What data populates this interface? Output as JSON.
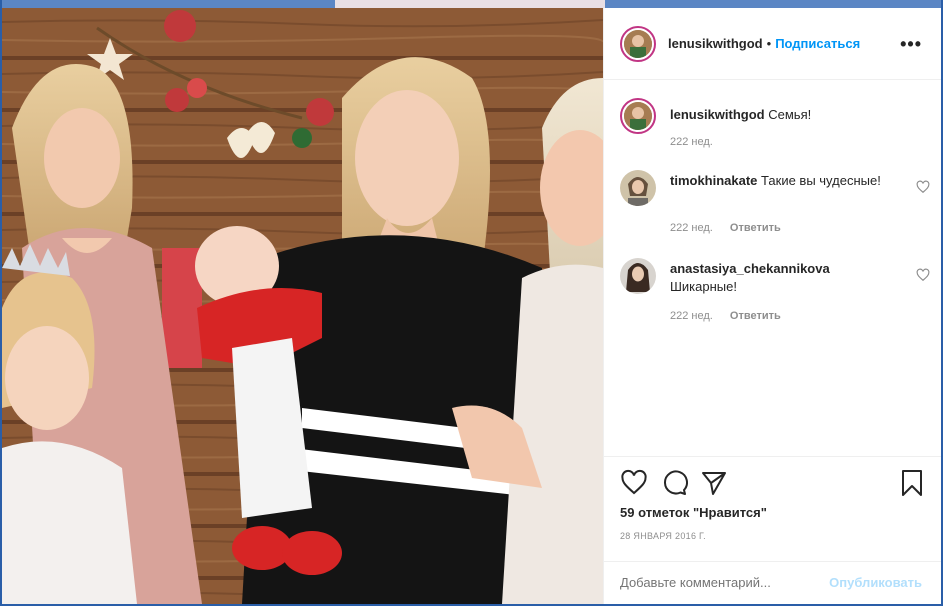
{
  "post": {
    "author": "lenusikwithgod",
    "dot": "•",
    "follow_label": "Подписаться",
    "more_label": "•••",
    "photo_alt": "Семейное фото"
  },
  "caption": {
    "username": "lenusikwithgod",
    "text": "Семья!",
    "time": "222 нед."
  },
  "comments": [
    {
      "username": "timokhinakate",
      "text": "Такие вы чудесные!",
      "time": "222 нед.",
      "reply": "Ответить"
    },
    {
      "username": "anastasiya_chekannikova",
      "text": "Шикарные!",
      "time": "222 нед.",
      "reply": "Ответить"
    }
  ],
  "actions": {
    "like_icon": "heart-icon",
    "comment_icon": "comment-icon",
    "share_icon": "share-icon",
    "save_icon": "bookmark-icon",
    "likes_text": "59 отметок \"Нравится\"",
    "date": "28 ЯНВАРЯ 2016 Г."
  },
  "add_comment": {
    "placeholder": "Добавьте комментарий...",
    "post_label": "Опубликовать"
  },
  "colors": {
    "link": "#0095f6",
    "post_disabled": "#b2dffc",
    "secondary_text": "#8e8e8e",
    "story_ring": "#c13584"
  }
}
